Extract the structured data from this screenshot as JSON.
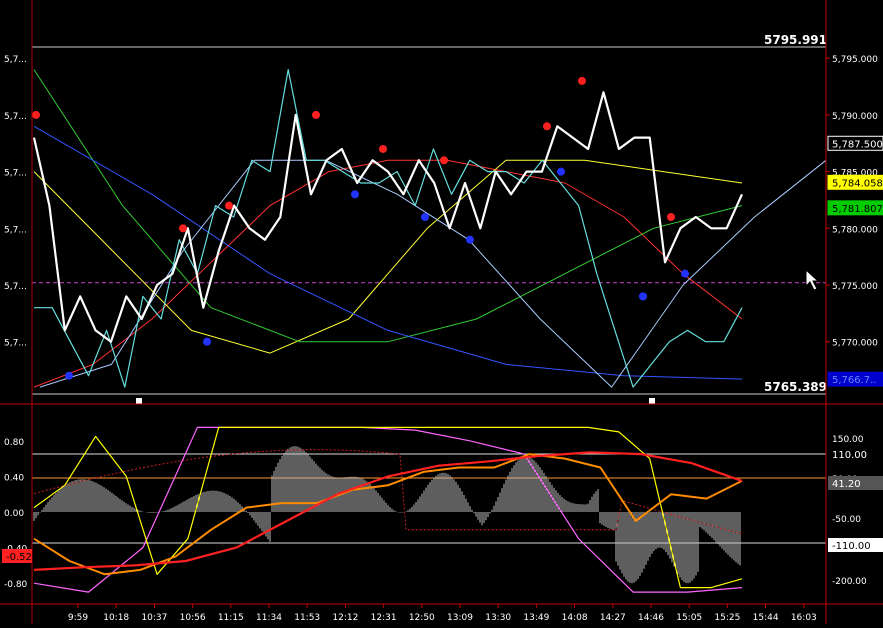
{
  "chart_data": [
    {
      "type": "line",
      "panel": "price",
      "y_axis_ticks": [
        "5,795.000",
        "5,790.000",
        "5,785.000",
        "5,780.000",
        "5,775.000",
        "5,770.000"
      ],
      "y_axis_ticks_left": [
        "5,7...",
        "5,7...",
        "5,7...",
        "5,7...",
        "5,7...",
        "5,7..."
      ],
      "ylim": [
        5765.389,
        5795.991
      ],
      "level_labels": {
        "high": "5795.991",
        "low": "5765.389"
      },
      "price_tags": [
        {
          "value": "5,787.500",
          "color": "#000000",
          "text_color": "#ffffff"
        },
        {
          "value": "5,784.058",
          "color": "#ffff00",
          "text_color": "#000000"
        },
        {
          "value": "5,781.807",
          "color": "#00cc00",
          "text_color": "#000000"
        },
        {
          "value": "5,766.7..",
          "color": "#0000cc",
          "text_color": "#6688ff"
        }
      ],
      "dashed_level": 5775.2,
      "series": [
        {
          "color": "#ffffff",
          "values": [
            5788,
            5782,
            5771,
            5774,
            5771,
            5770,
            5774,
            5772,
            5775,
            5776,
            5780,
            5773,
            5778,
            5782,
            5780,
            5779,
            5781,
            5790,
            5783,
            5786,
            5787,
            5784,
            5786,
            5785,
            5783,
            5786,
            5784,
            5780,
            5784,
            5780,
            5785,
            5783,
            5785,
            5785,
            5789,
            5788,
            5787,
            5792,
            5787,
            5788,
            5788,
            5777,
            5780,
            5781,
            5780,
            5780,
            5783
          ]
        },
        {
          "color": "#66dddd",
          "values": [
            5773,
            5773,
            5770,
            5767,
            5771,
            5766,
            5774,
            5772,
            5779,
            5776,
            5782,
            5781,
            5786,
            5785,
            5794,
            5786,
            5786,
            5785,
            5784,
            5784,
            5785,
            5782,
            5787,
            5783,
            5786,
            5785,
            5785,
            5784,
            5786,
            5784,
            5782,
            5776,
            5771,
            5766,
            5768,
            5770,
            5771,
            5770,
            5770,
            5773
          ]
        },
        {
          "color": "#ff3333",
          "values": [
            5766,
            5768,
            5772,
            5777,
            5782,
            5785,
            5786,
            5786,
            5785,
            5784,
            5781,
            5776,
            5772
          ]
        },
        {
          "color": "#ffff33",
          "values": [
            5785,
            5778,
            5771,
            5769,
            5772,
            5780,
            5786,
            5786,
            5785,
            5784
          ]
        },
        {
          "color": "#33cc33",
          "values": [
            5794,
            5782,
            5773,
            5770,
            5770,
            5772,
            5776,
            5780,
            5782
          ]
        },
        {
          "color": "#3355ff",
          "values": [
            5789,
            5783,
            5776,
            5771,
            5768,
            5767,
            5766.7
          ]
        },
        {
          "color": "#aaccff",
          "values": [
            5766,
            5768,
            5778,
            5786,
            5786,
            5783,
            5779,
            5772,
            5766,
            5775,
            5781,
            5786
          ]
        }
      ],
      "dots": [
        {
          "series": "red",
          "values": [
            5790,
            5780,
            5782,
            5790,
            5787,
            5786,
            5789,
            5793,
            5781
          ]
        },
        {
          "series": "blue",
          "values": [
            5767,
            5770,
            5783,
            5781,
            5779,
            5774,
            5785,
            5774,
            5776
          ]
        }
      ]
    },
    {
      "type": "line",
      "panel": "oscillator",
      "y_axis_ticks_left": [
        "0.80",
        "0.40",
        "0.00",
        "-0.40",
        "-0.80"
      ],
      "y_axis_ticks_right": [
        "150.00",
        "50.00",
        "-50.00",
        "-100.00",
        "-200.00"
      ],
      "ylim": [
        -0.95,
        0.95
      ],
      "level_labels": {
        "upper": "110.00",
        "lower": "-110.00"
      },
      "value_tags": [
        {
          "value": "-0.52",
          "color": "#ff2020",
          "text_color": "#000000"
        },
        {
          "value": "41.20",
          "color": "#555555",
          "text_color": "#ffffff"
        },
        {
          "value": "-110.00",
          "color": "#ffffff",
          "text_color": "#000000"
        }
      ],
      "series": [
        {
          "color": "#ffff00",
          "values": [
            0.05,
            0.3,
            0.85,
            0.4,
            -0.7,
            -0.3,
            0.95,
            0.95,
            0.95,
            0.95,
            0.95,
            0.95,
            0.95,
            0.95,
            0.95,
            0.95,
            0.95,
            0.95,
            0.95,
            0.9,
            0.6,
            -0.85,
            -0.85,
            -0.75
          ]
        },
        {
          "color": "#ff8c00",
          "values": [
            -0.3,
            -0.55,
            -0.7,
            -0.65,
            -0.5,
            -0.2,
            0.05,
            0.1,
            0.1,
            0.25,
            0.3,
            0.45,
            0.5,
            0.5,
            0.65,
            0.6,
            0.5,
            -0.1,
            0.2,
            0.15,
            0.35
          ]
        },
        {
          "color": "#ff2020",
          "values": [
            -0.65,
            -0.62,
            -0.6,
            -0.55,
            -0.4,
            -0.1,
            0.2,
            0.4,
            0.52,
            0.57,
            0.63,
            0.67,
            0.65,
            0.55,
            0.35
          ]
        },
        {
          "color": "#ff66ff",
          "values": [
            -0.8,
            -0.9,
            -0.4,
            0.95,
            0.95,
            0.95,
            0.95,
            0.92,
            0.8,
            0.65,
            -0.3,
            -0.9,
            -0.9,
            -0.85
          ]
        }
      ]
    }
  ],
  "x_axis_ticks": [
    "9:59",
    "10:18",
    "10:37",
    "10:56",
    "11:15",
    "11:34",
    "11:53",
    "12:12",
    "12:31",
    "12:50",
    "13:09",
    "13:30",
    "13:49",
    "14:08",
    "14:27",
    "14:46",
    "15:05",
    "15:25",
    "15:44",
    "16:03"
  ]
}
